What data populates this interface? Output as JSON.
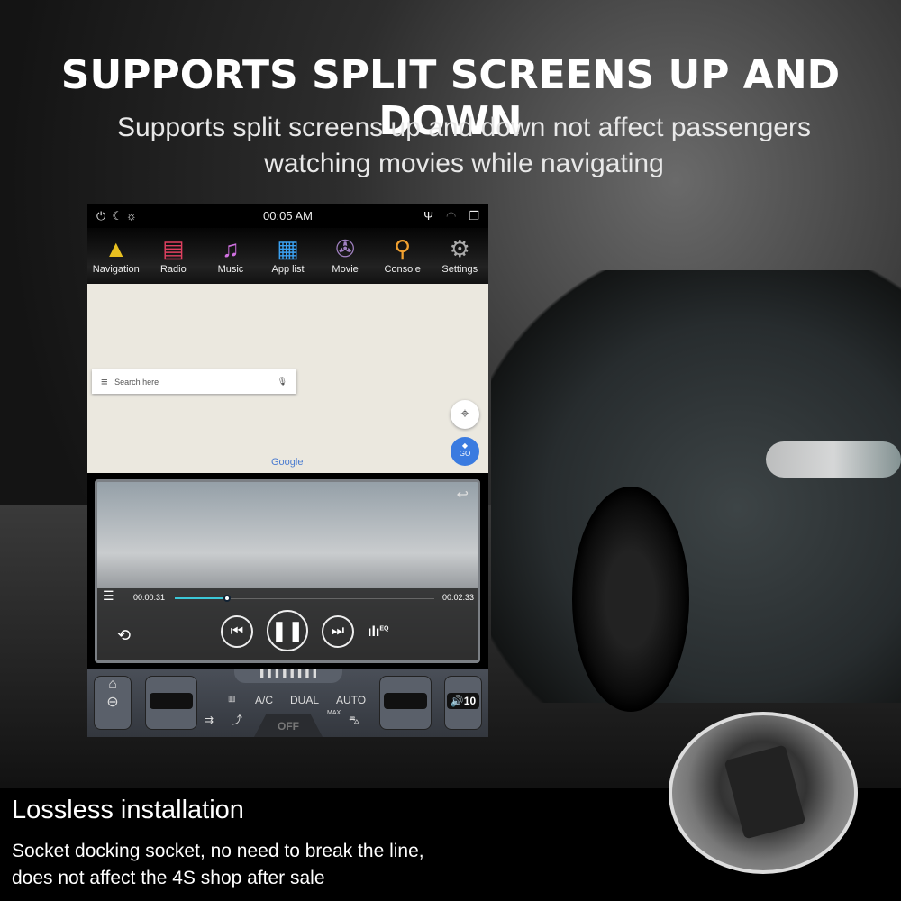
{
  "headline": "SUPPORTS SPLIT SCREENS UP AND DOWN",
  "subheadline": [
    "Supports split screens up and down not affect passengers",
    "watching movies while navigating"
  ],
  "device": {
    "status_bar": {
      "time": "00:05 AM",
      "icons": [
        "power-icon",
        "night-mode-icon",
        "brightness-icon",
        "usb-icon",
        "wifi-icon",
        "windows-icon"
      ]
    },
    "apps": [
      {
        "label": "Navigation",
        "icon": "navigation-icon"
      },
      {
        "label": "Radio",
        "icon": "radio-icon"
      },
      {
        "label": "Music",
        "icon": "music-icon"
      },
      {
        "label": "App list",
        "icon": "app-list-icon"
      },
      {
        "label": "Movie",
        "icon": "movie-icon"
      },
      {
        "label": "Console",
        "icon": "console-icon"
      },
      {
        "label": "Settings",
        "icon": "settings-icon"
      }
    ],
    "map": {
      "search_placeholder": "Search here",
      "go_label": "GO",
      "brand": "Google"
    },
    "video": {
      "elapsed": "00:00:31",
      "total": "00:02:33",
      "progress": 0.2,
      "eq_label": "EQ"
    },
    "climate": {
      "ac": "A/C",
      "dual": "DUAL",
      "auto": "AUTO",
      "off": "OFF",
      "max": "MAX",
      "volume": "10"
    }
  },
  "footer": {
    "title": "Lossless installation",
    "lines": [
      "Socket docking socket, no need to break the line,",
      "does not affect the 4S shop after sale"
    ]
  }
}
